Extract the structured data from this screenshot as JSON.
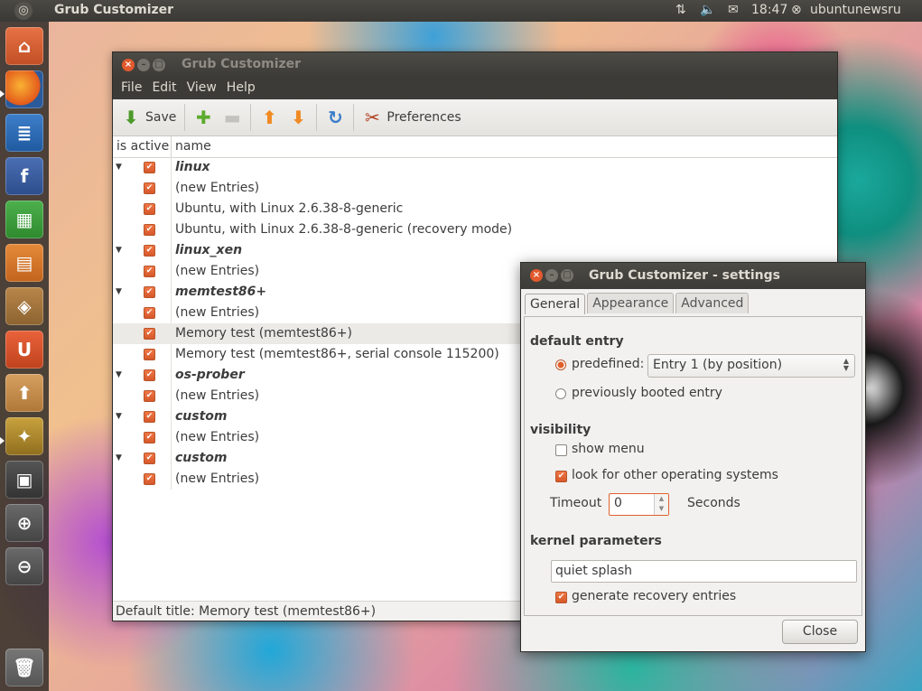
{
  "panel": {
    "app_title": "Grub Customizer",
    "time": "18:47",
    "user": "ubuntunewsru"
  },
  "launcher": {
    "items": [
      "home-folder",
      "firefox",
      "writer",
      "facebook",
      "calc",
      "impress",
      "software-center",
      "ubuntu-one",
      "archive",
      "grub-customizer",
      "workspaces",
      "zoom-in",
      "zoom-out",
      "trash"
    ]
  },
  "main_window": {
    "title": "Grub Customizer",
    "menu": [
      "File",
      "Edit",
      "View",
      "Help"
    ],
    "toolbar": {
      "save": "Save",
      "preferences": "Preferences"
    },
    "columns": {
      "active": "is active",
      "name": "name"
    },
    "rows": [
      {
        "name": "linux",
        "group": true,
        "active": true
      },
      {
        "name": "(new Entries)",
        "group": false,
        "active": true
      },
      {
        "name": "Ubuntu, with Linux 2.6.38-8-generic",
        "group": false,
        "active": true
      },
      {
        "name": "Ubuntu, with Linux 2.6.38-8-generic (recovery mode)",
        "group": false,
        "active": true
      },
      {
        "name": "linux_xen",
        "group": true,
        "active": true
      },
      {
        "name": "(new Entries)",
        "group": false,
        "active": true
      },
      {
        "name": "memtest86+",
        "group": true,
        "active": true
      },
      {
        "name": "(new Entries)",
        "group": false,
        "active": true
      },
      {
        "name": "Memory test (memtest86+)",
        "group": false,
        "active": true,
        "selected": true
      },
      {
        "name": "Memory test (memtest86+, serial console 115200)",
        "group": false,
        "active": true
      },
      {
        "name": "os-prober",
        "group": true,
        "active": true
      },
      {
        "name": "(new Entries)",
        "group": false,
        "active": true
      },
      {
        "name": "custom",
        "group": true,
        "active": true
      },
      {
        "name": "(new Entries)",
        "group": false,
        "active": true
      },
      {
        "name": "custom",
        "group": true,
        "active": true
      },
      {
        "name": "(new Entries)",
        "group": false,
        "active": true
      }
    ],
    "status": "Default title: Memory test (memtest86+)"
  },
  "settings": {
    "title": "Grub Customizer - settings",
    "tabs": [
      "General",
      "Appearance",
      "Advanced"
    ],
    "active_tab": "General",
    "default_entry": {
      "heading": "default entry",
      "predefined_label": "predefined:",
      "predefined_value": "Entry 1 (by position)",
      "previously_label": "previously booted entry"
    },
    "visibility": {
      "heading": "visibility",
      "show_menu": "show menu",
      "show_menu_checked": false,
      "look_for_os": "look for other operating systems",
      "look_for_os_checked": true,
      "timeout_label": "Timeout",
      "timeout_value": "0",
      "seconds_label": "Seconds"
    },
    "kernel": {
      "heading": "kernel parameters",
      "params": "quiet splash",
      "recovery": "generate recovery entries",
      "recovery_checked": true
    },
    "close": "Close"
  },
  "colors": {
    "accent": "#e0602c",
    "titlebar": "#3c3b37"
  }
}
